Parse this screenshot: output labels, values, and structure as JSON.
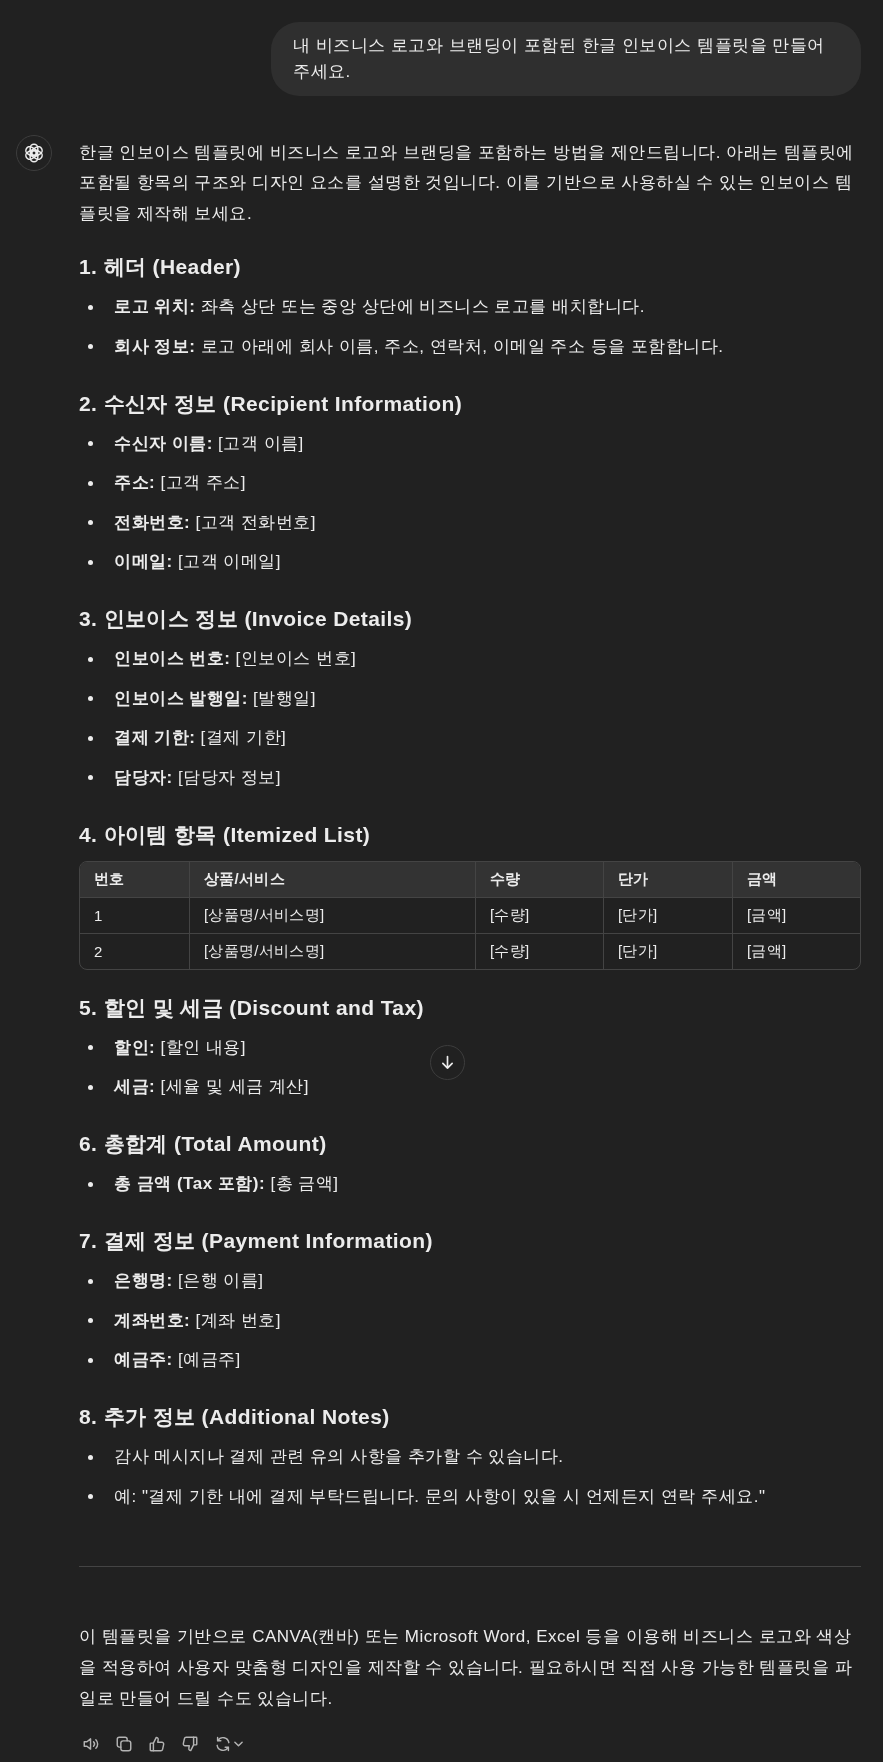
{
  "user_message": {
    "text": "내 비즈니스 로고와 브랜딩이 포함된 한글 인보이스 템플릿을 만들어 주세요."
  },
  "assistant_message": {
    "intro": "한글 인보이스 템플릿에 비즈니스 로고와 브랜딩을 포함하는 방법을 제안드립니다. 아래는 템플릿에 포함될 항목의 구조와 디자인 요소를 설명한 것입니다. 이를 기반으로 사용하실 수 있는 인보이스 템플릿을 제작해 보세요.",
    "sections": [
      {
        "kind": "list",
        "heading": "1. 헤더 (Header)",
        "items": [
          "**로고 위치:** 좌측 상단 또는 중앙 상단에 비즈니스 로고를 배치합니다.",
          "**회사 정보:** 로고 아래에 회사 이름, 주소, 연락처, 이메일 주소 등을 포함합니다."
        ]
      },
      {
        "kind": "list",
        "heading": "2. 수신자 정보 (Recipient Information)",
        "items": [
          "**수신자 이름:** [고객 이름]",
          "**주소:** [고객 주소]",
          "**전화번호:** [고객 전화번호]",
          "**이메일:** [고객 이메일]"
        ]
      },
      {
        "kind": "list",
        "heading": "3. 인보이스 정보 (Invoice Details)",
        "items": [
          "**인보이스 번호:** [인보이스 번호]",
          "**인보이스 발행일:** [발행일]",
          "**결제 기한:** [결제 기한]",
          "**담당자:** [담당자 정보]"
        ]
      },
      {
        "kind": "table",
        "heading": "4. 아이템 항목 (Itemized List)",
        "table": {
          "columns": [
            "번호",
            "상품/서비스",
            "수량",
            "단가",
            "금액"
          ],
          "rows": [
            [
              "1",
              "[상품명/서비스명]",
              "[수량]",
              "[단가]",
              "[금액]"
            ],
            [
              "2",
              "[상품명/서비스명]",
              "[수량]",
              "[단가]",
              "[금액]"
            ]
          ]
        }
      },
      {
        "kind": "list",
        "heading": "5. 할인 및 세금 (Discount and Tax)",
        "items": [
          "**할인:** [할인 내용]",
          "**세금:** [세율 및 세금 계산]"
        ]
      },
      {
        "kind": "list",
        "heading": "6. 총합계 (Total Amount)",
        "items": [
          "**총 금액 (Tax 포함):** [총 금액]"
        ]
      },
      {
        "kind": "list",
        "heading": "7. 결제 정보 (Payment Information)",
        "items": [
          "**은행명:** [은행 이름]",
          "**계좌번호:** [계좌 번호]",
          "**예금주:** [예금주]"
        ]
      },
      {
        "kind": "list",
        "heading": "8. 추가 정보 (Additional Notes)",
        "items": [
          "감사 메시지나 결제 관련 유의 사항을 추가할 수 있습니다.",
          "예: \"결제 기한 내에 결제 부탁드립니다. 문의 사항이 있을 시 언제든지 연락 주세요.\""
        ]
      }
    ],
    "closing": "이 템플릿을 기반으로 CANVA(캔바) 또는 Microsoft Word, Excel 등을 이용해 비즈니스 로고와 색상을 적용하여 사용자 맞춤형 디자인을 제작할 수 있습니다. 필요하시면 직접 사용 가능한 템플릿을 파일로 만들어 드릴 수도 있습니다."
  }
}
